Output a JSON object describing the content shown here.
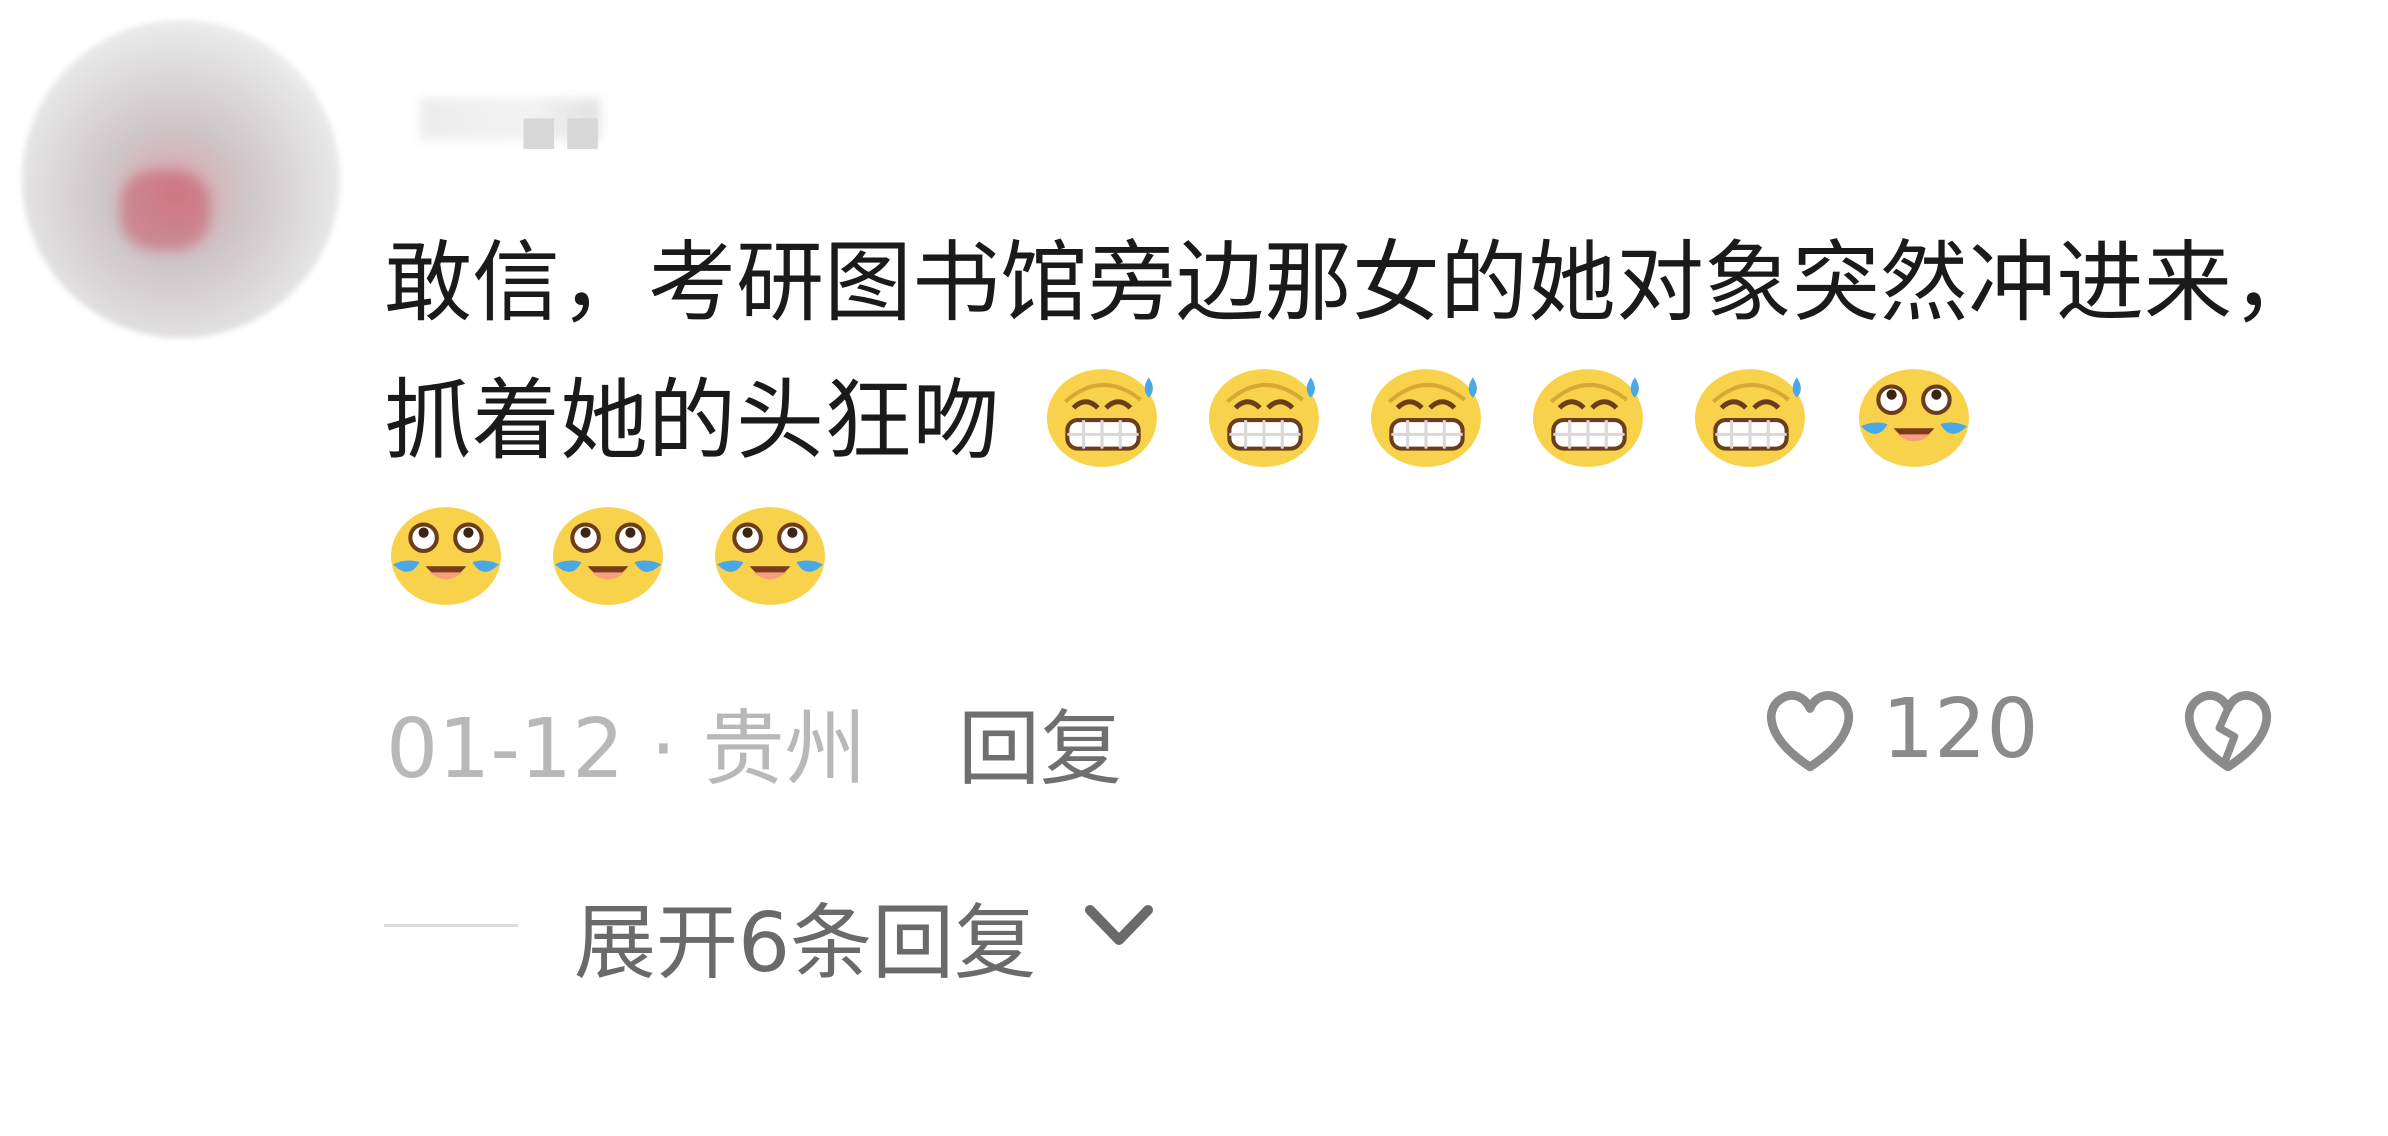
{
  "comment": {
    "text": "敢信，考研图书馆旁边那女的她对象突然冲进来，抓着她的头狂吻",
    "emojis": [
      "grinning-sweat-emoji",
      "grinning-sweat-emoji",
      "grinning-sweat-emoji",
      "grinning-sweat-emoji",
      "grinning-sweat-emoji",
      "tears-of-joy-emoji",
      "tears-of-joy-emoji",
      "tears-of-joy-emoji",
      "tears-of-joy-emoji"
    ]
  },
  "meta": {
    "date_location": "01-12 · 贵州",
    "reply_label": "回复",
    "like_count": "120"
  },
  "replies": {
    "expand_label": "展开6条回复"
  },
  "icons": {
    "like": "heart-outline-icon",
    "dislike": "broken-heart-icon",
    "expand": "chevron-down-icon"
  },
  "colors": {
    "text": "#1a1a1a",
    "muted": "#b8b8b8",
    "secondary": "#6f6f6f",
    "icon": "#8b8b8b"
  }
}
